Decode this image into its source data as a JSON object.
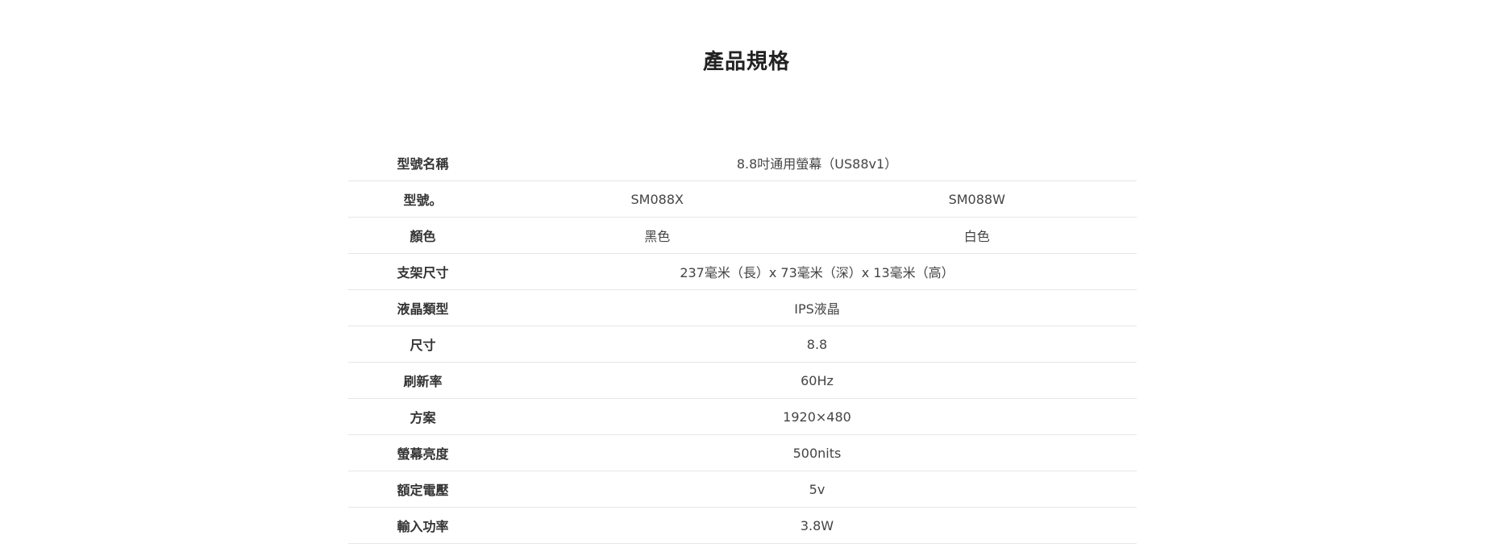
{
  "page": {
    "title": "產品規格"
  },
  "specs": {
    "rows": [
      {
        "label": "型號名稱",
        "value": "8.8吋通用螢幕（US88v1）"
      },
      {
        "label": "型號。",
        "values": [
          "SM088X",
          "SM088W"
        ]
      },
      {
        "label": "顏色",
        "values": [
          "黑色",
          "白色"
        ]
      },
      {
        "label": "支架尺寸",
        "value": "237毫米（長）x 73毫米（深）x 13毫米（高）"
      },
      {
        "label": "液晶類型",
        "value": "IPS液晶"
      },
      {
        "label": "尺寸",
        "value": "8.8"
      },
      {
        "label": "刷新率",
        "value": "60Hz"
      },
      {
        "label": "方案",
        "value": "1920×480"
      },
      {
        "label": "螢幕亮度",
        "value": "500nits"
      },
      {
        "label": "額定電壓",
        "value": "5v"
      },
      {
        "label": "輸入功率",
        "value": "3.8W"
      }
    ]
  }
}
